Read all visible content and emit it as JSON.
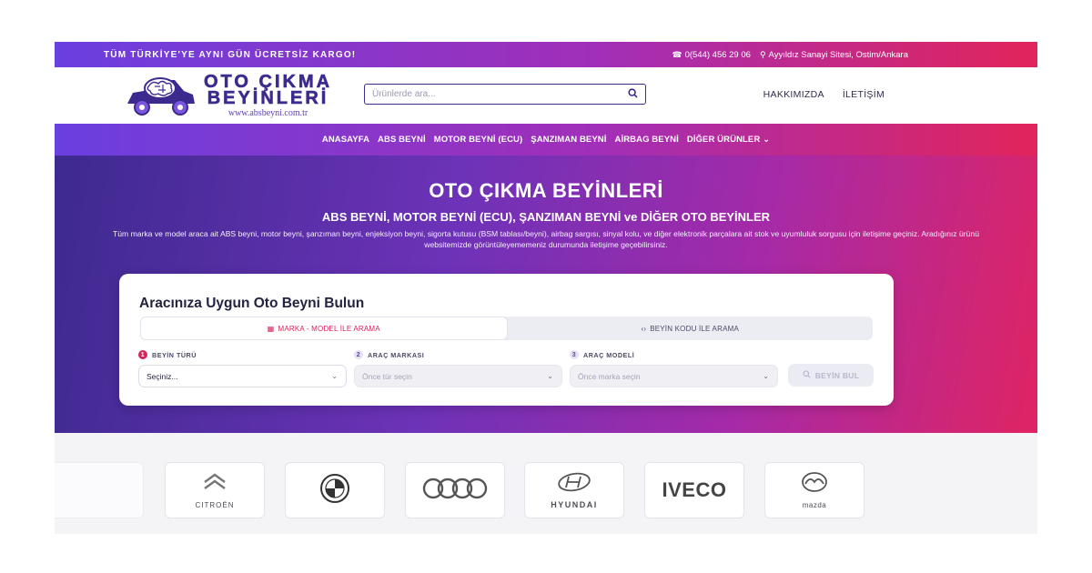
{
  "topbar": {
    "promo": "TÜM TÜRKİYE'YE AYNI GÜN ÜCRETSİZ KARGO!",
    "phone_icon": "phone-icon",
    "phone": "0(544) 456 29 06",
    "location_icon": "map-pin-icon",
    "address": "Ayyıldız Sanayi Sitesi, Ostim/Ankara"
  },
  "header": {
    "logo": {
      "line1": "OTO ÇIKMA",
      "line2": "BEYİNLERİ",
      "url": "www.absbeyni.com.tr"
    },
    "search": {
      "placeholder": "Ürünlerde ara...",
      "icon": "search-icon"
    },
    "links": [
      "HAKKIMIZDA",
      "İLETİŞİM"
    ]
  },
  "nav": {
    "items": [
      "ANASAYFA",
      "ABS BEYNİ",
      "MOTOR BEYNİ (ECU)",
      "ŞANZIMAN BEYNİ",
      "AİRBAG BEYNİ",
      "DİĞER ÜRÜNLER ⌄"
    ]
  },
  "hero": {
    "title": "OTO ÇIKMA BEYİNLERİ",
    "subtitle": "ABS BEYNİ, MOTOR BEYNİ (ECU), ŞANZIMAN BEYNİ ve DİĞER OTO BEYİNLER",
    "text": "Tüm marka ve model araca ait ABS beyni, motor beyni, şanzıman beyni, enjeksiyon beyni, sigorta kutusu (BSM tablası/beyni), airbag sargısı, sinyal kolu, ve diğer elektronik parçalara ait stok ve uyumluluk sorgusu için iletişime geçiniz. Aradığınız ürünü websitemizde görüntüleyememeniz durumunda iletişime geçebilirsiniz."
  },
  "finder": {
    "title": "Aracınıza Uygun Oto Beyni Bulun",
    "tabs": [
      {
        "label": "MARKA - MODEL İLE ARAMA",
        "icon": "grid-icon",
        "icon_glyph": "▦",
        "active": true
      },
      {
        "label": "BEYİN KODU İLE ARAMA",
        "icon": "code-icon",
        "icon_glyph": "‹›",
        "active": false
      }
    ],
    "fields": [
      {
        "step": "1",
        "label": "BEYİN TÜRÜ",
        "value": "Seçiniz...",
        "disabled": false
      },
      {
        "step": "2",
        "label": "ARAÇ MARKASI",
        "value": "Önce tür seçin",
        "disabled": true
      },
      {
        "step": "3",
        "label": "ARAÇ MODELİ",
        "value": "Önce marka seçin",
        "disabled": true
      }
    ],
    "button": "BEYİN BUL",
    "button_icon": "search-icon"
  },
  "brands": [
    {
      "name": "CITROËN",
      "label": "CITROËN"
    },
    {
      "name": "BMW",
      "label": ""
    },
    {
      "name": "Audi",
      "label": ""
    },
    {
      "name": "HYUNDAI",
      "label": "HYUNDAI"
    },
    {
      "name": "IVECO",
      "label": "IVECO"
    },
    {
      "name": "mazda",
      "label": "mazda"
    }
  ],
  "colors": {
    "accent": "#d6245a",
    "brand": "#3d2a8f",
    "gradient_start": "#6a3fe0",
    "gradient_end": "#e2245a"
  }
}
